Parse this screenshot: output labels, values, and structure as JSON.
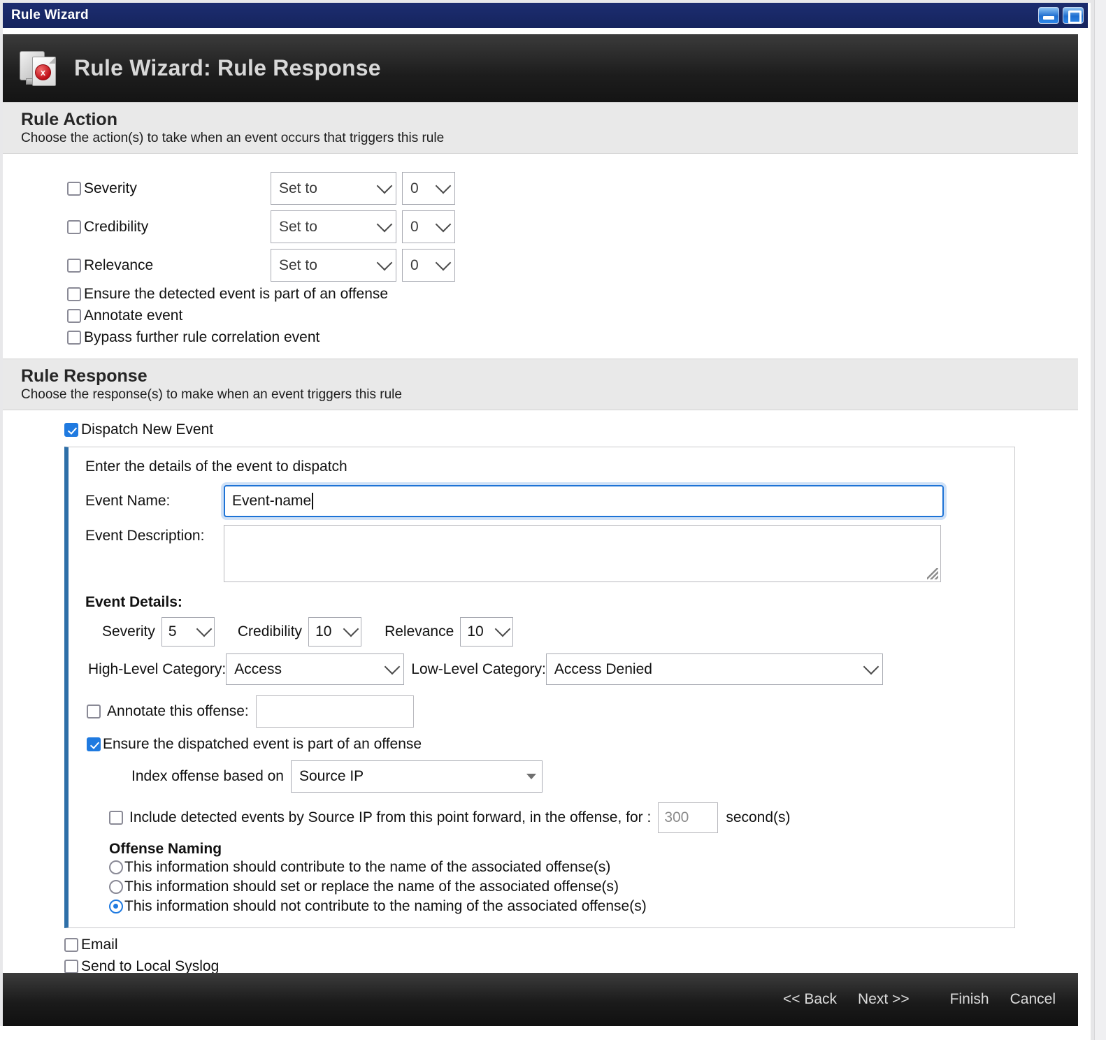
{
  "window": {
    "title": "Rule Wizard",
    "minimize_icon": "minimize-icon",
    "maximize_icon": "maximize-icon"
  },
  "header": {
    "title": "Rule Wizard: Rule Response",
    "icon": "rule-error-document-icon",
    "badge": "x"
  },
  "rule_action": {
    "title": "Rule Action",
    "subtitle": "Choose the action(s) to take when an event occurs that triggers this rule",
    "rows": [
      {
        "label": "Severity",
        "checked": false,
        "mode": "Set to",
        "value": "0"
      },
      {
        "label": "Credibility",
        "checked": false,
        "mode": "Set to",
        "value": "0"
      },
      {
        "label": "Relevance",
        "checked": false,
        "mode": "Set to",
        "value": "0"
      }
    ],
    "checkboxes": [
      {
        "label": "Ensure the detected event is part of an offense",
        "checked": false
      },
      {
        "label": "Annotate event",
        "checked": false
      },
      {
        "label": "Bypass further rule correlation event",
        "checked": false
      }
    ]
  },
  "rule_response": {
    "title": "Rule Response",
    "subtitle": "Choose the response(s) to make when an event triggers this rule",
    "dispatch": {
      "label": "Dispatch New Event",
      "checked": true,
      "panel_intro": "Enter the details of the event to dispatch",
      "event_name_label": "Event Name:",
      "event_name_value": "Event-name",
      "event_description_label": "Event Description:",
      "event_description_value": "",
      "details_label": "Event Details:",
      "severity_label": "Severity",
      "severity_value": "5",
      "credibility_label": "Credibility",
      "credibility_value": "10",
      "relevance_label": "Relevance",
      "relevance_value": "10",
      "high_level_label": "High-Level Category:",
      "high_level_value": "Access",
      "low_level_label": "Low-Level Category:",
      "low_level_value": "Access Denied",
      "annotate_label": "Annotate this offense:",
      "annotate_checked": false,
      "annotate_value": "",
      "ensure_label": "Ensure the dispatched event is part of an offense",
      "ensure_checked": true,
      "index_label": "Index offense based on",
      "index_value": "Source IP",
      "include_label": "Include detected events by Source IP from this point forward, in the offense, for :",
      "include_checked": false,
      "include_seconds": "300",
      "seconds_suffix": "second(s)",
      "offense_naming_title": "Offense Naming",
      "offense_naming_options": [
        {
          "label": "This information should contribute to the name of the associated offense(s)",
          "selected": false
        },
        {
          "label": "This information should set or replace the name of the associated offense(s)",
          "selected": false
        },
        {
          "label": "This information should not contribute to the naming of the associated offense(s)",
          "selected": true
        }
      ]
    },
    "other_responses": [
      {
        "label": "Email",
        "checked": false
      },
      {
        "label": "Send to Local Syslog",
        "checked": false
      }
    ]
  },
  "footer": {
    "back": "<< Back",
    "next": "Next >>",
    "finish": "Finish",
    "cancel": "Cancel"
  }
}
